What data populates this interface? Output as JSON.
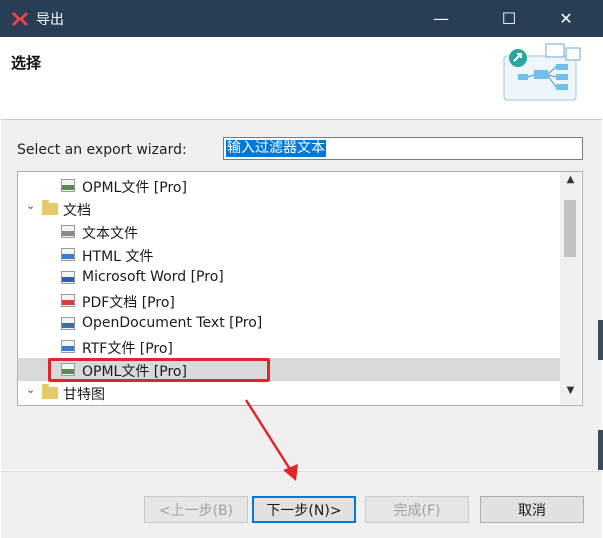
{
  "window": {
    "title": "导出",
    "minimize_glyph": "—",
    "maximize_glyph": "☐",
    "close_glyph": "✕"
  },
  "header": {
    "title": "选择"
  },
  "filter": {
    "label": "Select an export wizard:",
    "value": "输入过滤器文本"
  },
  "tree": {
    "items": [
      {
        "label": "OPML文件 [Pro]",
        "icon": "opml-file-icon",
        "type": "file"
      },
      {
        "label": "文档",
        "icon": "folder-icon",
        "type": "folder",
        "expanded": true
      },
      {
        "label": "文本文件",
        "icon": "txt-file-icon",
        "type": "file"
      },
      {
        "label": "HTML 文件",
        "icon": "html-file-icon",
        "type": "file"
      },
      {
        "label": "Microsoft Word [Pro]",
        "icon": "doc-file-icon",
        "type": "file"
      },
      {
        "label": "PDF文档 [Pro]",
        "icon": "pdf-file-icon",
        "type": "file"
      },
      {
        "label": "OpenDocument Text [Pro]",
        "icon": "odt-file-icon",
        "type": "file"
      },
      {
        "label": "RTF文件 [Pro]",
        "icon": "rtf-file-icon",
        "type": "file"
      },
      {
        "label": "OPML文件 [Pro]",
        "icon": "opml-file-icon",
        "type": "file",
        "selected": true
      },
      {
        "label": "甘特图",
        "icon": "folder-icon",
        "type": "folder",
        "expanded": true
      }
    ]
  },
  "buttons": {
    "back": "<上一步(B)",
    "next": "下一步(N)>",
    "finish": "完成(F)",
    "cancel": "取消"
  },
  "colors": {
    "titlebar": "#273e55",
    "selection": "#0078d7",
    "highlight_box": "#e0262b",
    "annotation_arrow": "#e0262b"
  }
}
